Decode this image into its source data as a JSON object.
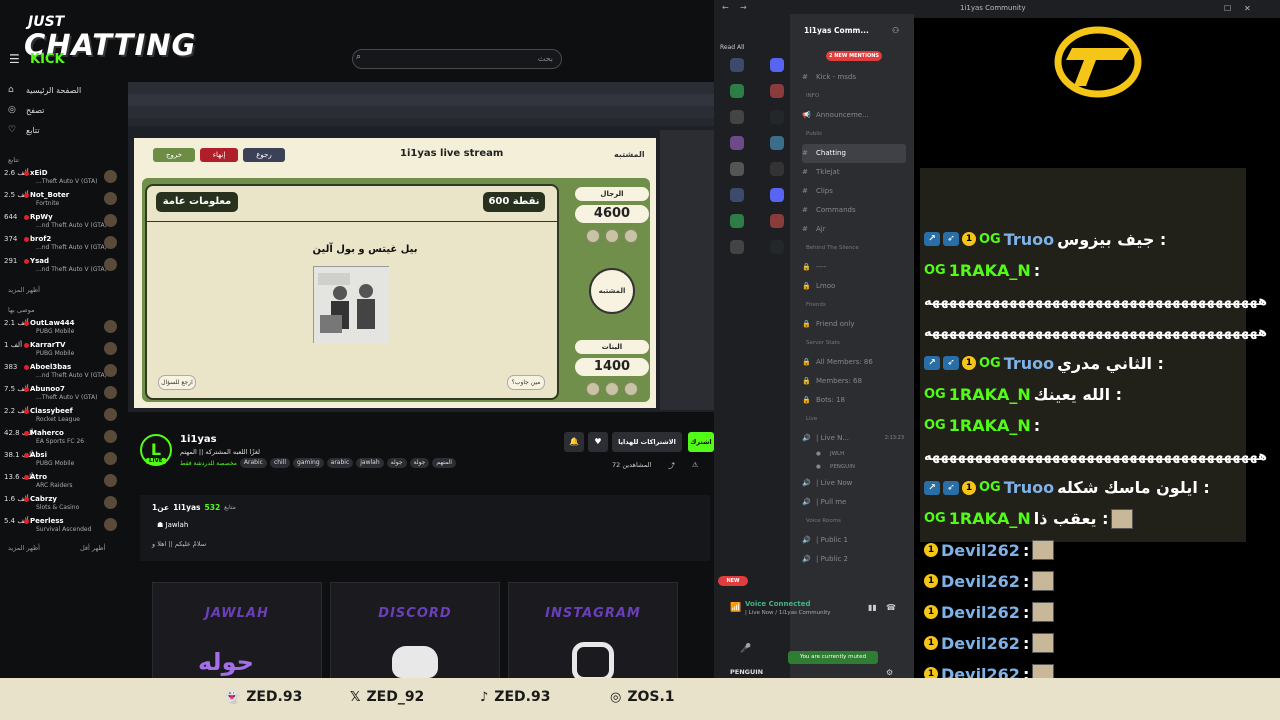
{
  "overlay": {
    "just": "JUST",
    "chatting": "CHATTING",
    "kick": "KICK"
  },
  "kick": {
    "search_placeholder": "بحث",
    "nav": [
      {
        "label": "الصفحة الرئيسية",
        "icon": "home-icon"
      },
      {
        "label": "تصفح",
        "icon": "compass-icon"
      },
      {
        "label": "تتابع",
        "icon": "heart-icon"
      }
    ],
    "following_header": "تتابع",
    "following": [
      {
        "viewers": "2.6 ألف",
        "name": "xEiD",
        "game": "...Theft Auto V (GTA)"
      },
      {
        "viewers": "2.5 ألف",
        "name": "Not_Boter",
        "game": "Fortnite"
      },
      {
        "viewers": "644",
        "name": "RpWy",
        "game": "...nd Theft Auto V (GTA)"
      },
      {
        "viewers": "374",
        "name": "brof2",
        "game": "...nd Theft Auto V (GTA)"
      },
      {
        "viewers": "291",
        "name": "Ysad",
        "game": "...nd Theft Auto V (GTA)"
      }
    ],
    "show_more_1": "أظهر المزيد",
    "recommended_header": "موصى بها",
    "recommended": [
      {
        "viewers": "2.1 ألف",
        "name": "OutLaw444",
        "game": "PUBG Mobile"
      },
      {
        "viewers": "1 ألف",
        "name": "KarrarTV",
        "game": "PUBG Mobile"
      },
      {
        "viewers": "383",
        "name": "Aboel3bas",
        "game": "...nd Theft Auto V (GTA)"
      },
      {
        "viewers": "7.5 ألف",
        "name": "Abunoo7",
        "game": "...Theft Auto V (GTA)"
      },
      {
        "viewers": "2.2 ألف",
        "name": "Classybeef",
        "game": "Rocket League"
      },
      {
        "viewers": "42.8 ألف",
        "name": "Maherco",
        "game": "EA Sports FC 26"
      },
      {
        "viewers": "38.1 ألف",
        "name": "Absi",
        "game": "PUBG Mobile"
      },
      {
        "viewers": "13.6 ألف",
        "name": "Atro",
        "game": "ARC Raiders"
      },
      {
        "viewers": "1.6 ألف",
        "name": "Cabrzy",
        "game": "Slots & Casino"
      },
      {
        "viewers": "5.4 ألف",
        "name": "Peerless",
        "game": "Survival Ascended"
      }
    ],
    "show_more_2": "أظهر المزيد",
    "show_less": "أظهر أقل",
    "stream": {
      "game_title": "1i1yas live stream",
      "btn_back": "رجوع",
      "btn_end": "إنهاء",
      "btn_exit": "خروج",
      "info_label": "معلومات عامة",
      "points": "600 نقطة",
      "question": "بيل غيتس و بول آلين",
      "back_question": "ارجع للسؤال",
      "show_answer": "مين جاوب؟",
      "team_men": "الرجال",
      "score_men": "4600",
      "team_girls": "البنات",
      "score_girls": "1400",
      "logo_text": "المشتبه"
    },
    "channel": {
      "avatar_letter": "L",
      "live": "LIVE",
      "name": "1i1yas",
      "title": "لغزًا اللعبه المشتركه || المهتم",
      "category": "مخصصة للدردشة فقط",
      "tags": [
        "Arabic",
        "chill",
        "gaming",
        "arabic",
        "jawlah",
        "جوله",
        "جولة",
        "المتهم"
      ],
      "follow": "اشترك",
      "subscribe": "الاشتراكات للهدايا",
      "viewers": "72 المشاهدين",
      "about_name": "1i1yas",
      "about_followers_count": "532",
      "about_followers_label": "متابع",
      "about_pre": "1عن",
      "about_jawlah": "Jawlah",
      "about_desc": "سلامٌ عليكم || اهلا و"
    },
    "panels": [
      "JAWLAH",
      "DISCORD",
      "INSTAGRAM"
    ]
  },
  "discord": {
    "read_all": "Read All",
    "server_name": "1i1yas Comm...",
    "mentions": "2 NEW MENTIONS",
    "channels": [
      {
        "type": "text",
        "label": "Kick - msds"
      },
      {
        "type": "cat",
        "label": "INFO"
      },
      {
        "type": "announce",
        "label": "Announceme..."
      },
      {
        "type": "cat",
        "label": "Public"
      },
      {
        "type": "text",
        "label": "Chatting",
        "active": true
      },
      {
        "type": "text",
        "label": "Tklejat"
      },
      {
        "type": "text",
        "label": "Clips"
      },
      {
        "type": "text",
        "label": "Commands"
      },
      {
        "type": "text",
        "label": "Ajr"
      },
      {
        "type": "cat",
        "label": "Behind The Silence"
      },
      {
        "type": "lock",
        "label": "----"
      },
      {
        "type": "lock",
        "label": "Lmoo"
      },
      {
        "type": "cat",
        "label": "Friends"
      },
      {
        "type": "lock",
        "label": "Friend only"
      },
      {
        "type": "cat",
        "label": "Server Stats"
      },
      {
        "type": "lock",
        "label": "All Members: 86"
      },
      {
        "type": "lock",
        "label": "Members: 68"
      },
      {
        "type": "lock",
        "label": "Bots: 18"
      },
      {
        "type": "cat",
        "label": "Live"
      },
      {
        "type": "voice",
        "label": "| Live N...",
        "time": "2:13:23"
      },
      {
        "type": "user",
        "label": "JWLH"
      },
      {
        "type": "user",
        "label": "PENGUIN"
      },
      {
        "type": "voice",
        "label": "| Live Now"
      },
      {
        "type": "voice",
        "label": "| Pull me"
      },
      {
        "type": "cat",
        "label": "Voice Rooms"
      },
      {
        "type": "voice",
        "label": "| Public 1"
      },
      {
        "type": "voice",
        "label": "| Public 2"
      }
    ],
    "new_badge": "NEW",
    "voice_connected": "Voice Connected",
    "voice_sub": "| Live Now / 1i1yas Community",
    "muted": "You are currently muted",
    "user": "PENGUIN"
  },
  "chat": {
    "window_title": "1i1yas Community",
    "messages": [
      {
        "user": "Truoo",
        "color": "#7fb2e6",
        "text": "جيف بيزوس :",
        "badges": "full"
      },
      {
        "user": "1RAKA_N",
        "color": "#53fc18",
        "text": ":",
        "badges": "og"
      },
      {
        "user": "",
        "color": "#ffffff",
        "text": "هههههههههههههههههههههههههههههههههههههههه",
        "badges": "none"
      },
      {
        "user": "",
        "color": "#ffffff",
        "text": "هههههههههههههههههههههههههههههههههههههههه",
        "badges": "none"
      },
      {
        "user": "Truoo",
        "color": "#7fb2e6",
        "text": "الثاني مدري :",
        "badges": "full"
      },
      {
        "user": "1RAKA_N",
        "color": "#53fc18",
        "text": "الله يعينك :",
        "badges": "og"
      },
      {
        "user": "1RAKA_N",
        "color": "#53fc18",
        "text": ":",
        "badges": "og"
      },
      {
        "user": "",
        "color": "#ffffff",
        "text": "هههههههههههههههههههههههههههههههههههههههه",
        "badges": "none"
      },
      {
        "user": "Truoo",
        "color": "#7fb2e6",
        "text": "ايلون ماسك شكله :",
        "badges": "full"
      },
      {
        "user": "1RAKA_N",
        "color": "#53fc18",
        "text": "يعقب ذا :",
        "badges": "og"
      },
      {
        "user": "Devil262",
        "color": "#7fb2e6",
        "text": ":",
        "badges": "gift"
      },
      {
        "user": "Devil262",
        "color": "#7fb2e6",
        "text": ":",
        "badges": "gift"
      },
      {
        "user": "Devil262",
        "color": "#7fb2e6",
        "text": ":",
        "badges": "gift"
      },
      {
        "user": "Devil262",
        "color": "#7fb2e6",
        "text": ":",
        "badges": "gift"
      },
      {
        "user": "Devil262",
        "color": "#7fb2e6",
        "text": ":",
        "badges": "gift"
      }
    ]
  },
  "footer": {
    "socials": [
      {
        "icon": "snapchat-icon",
        "glyph": "👻",
        "handle": "ZED.93"
      },
      {
        "icon": "x-icon",
        "glyph": "𝕏",
        "handle": "ZED_92"
      },
      {
        "icon": "tiktok-icon",
        "glyph": "♪",
        "handle": "ZED.93"
      },
      {
        "icon": "instagram-icon",
        "glyph": "◎",
        "handle": "ZOS.1"
      }
    ]
  },
  "colors": {
    "kick_green": "#53fc18",
    "game_green": "#6f8f4b",
    "footer_bg": "#e7e2c9",
    "discord_bg": "#2b2d31"
  }
}
